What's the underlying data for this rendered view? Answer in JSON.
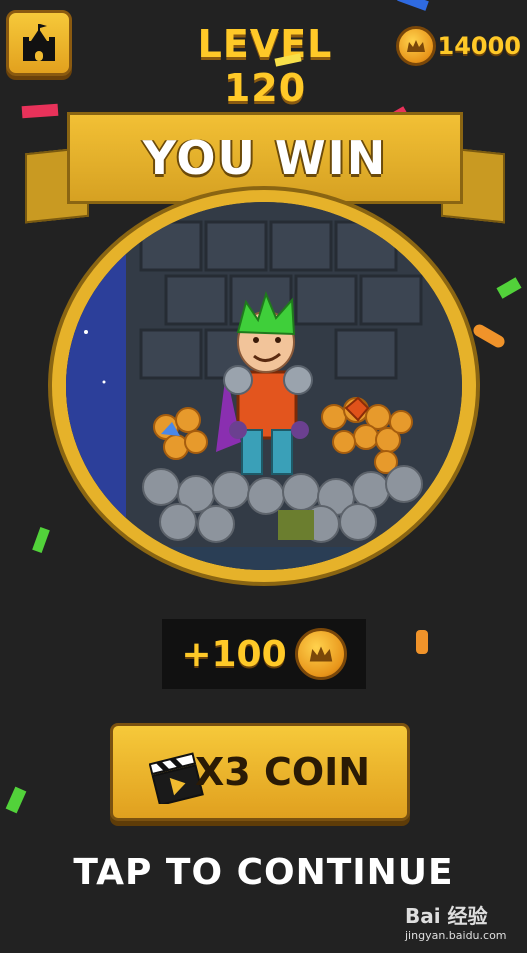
{
  "hud": {
    "level_title": "LEVEL 120",
    "coin_count": "14000"
  },
  "banner": {
    "title": "YOU WIN"
  },
  "reward": {
    "amount": "+100"
  },
  "x3_button": {
    "label": "X3 COIN"
  },
  "continue_text": "TAP TO CONTINUE",
  "watermark": {
    "logo": "Bai 经验",
    "url": "jingyan.baidu.com"
  },
  "icons": {
    "home": "castle-icon",
    "coin": "crown-coin-icon",
    "video": "clapperboard-icon"
  },
  "colors": {
    "background": "#222222",
    "gold": "#ffc928",
    "banner": "#e6b22a",
    "button": "#f0bb30"
  }
}
